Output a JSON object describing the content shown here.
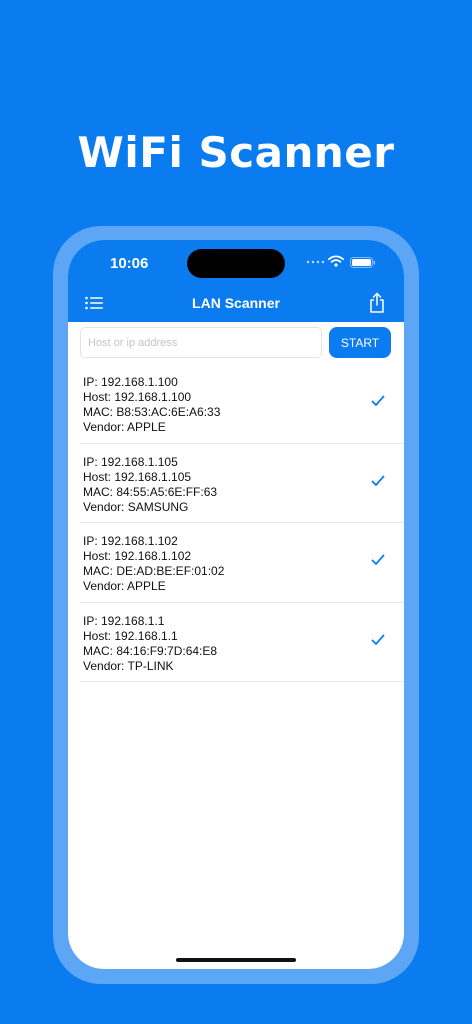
{
  "marketing": {
    "title": "WiFi Scanner"
  },
  "status_bar": {
    "time": "10:06"
  },
  "nav": {
    "title": "LAN Scanner"
  },
  "search": {
    "placeholder": "Host or ip address",
    "value": ""
  },
  "start_button": {
    "label": "START"
  },
  "devices": [
    {
      "ip": "IP: 192.168.1.100",
      "host": "Host: 192.168.1.100",
      "mac": "MAC: B8:53:AC:6E:A6:33",
      "vendor": "Vendor: APPLE"
    },
    {
      "ip": "IP: 192.168.1.105",
      "host": "Host: 192.168.1.105",
      "mac": "MAC: 84:55:A5:6E:FF:63",
      "vendor": "Vendor: SAMSUNG"
    },
    {
      "ip": "IP: 192.168.1.102",
      "host": "Host: 192.168.1.102",
      "mac": "MAC: DE:AD:BE:EF:01:02",
      "vendor": "Vendor: APPLE"
    },
    {
      "ip": "IP: 192.168.1.1",
      "host": "Host: 192.168.1.1",
      "mac": "MAC: 84:16:F9:7D:64:E8",
      "vendor": "Vendor: TP-LINK"
    }
  ],
  "icons": {
    "menu": "list-icon",
    "share": "share-icon",
    "check": "checkmark-icon",
    "wifi": "wifi-icon",
    "battery": "battery-icon",
    "signal": "signal-dots-icon"
  },
  "colors": {
    "brand": "#0a7cf0",
    "frame": "#5ca6f5",
    "check": "#0a7cf0"
  }
}
